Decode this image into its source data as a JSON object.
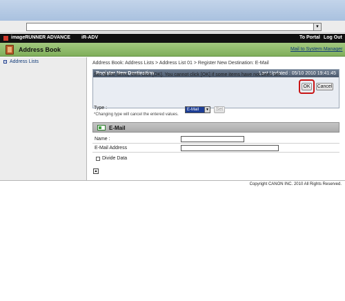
{
  "browser": {
    "url_arrow": "▼"
  },
  "header": {
    "product": "imageRUNNER ADVANCE",
    "model": "iR-ADV",
    "to_portal": "To Portal",
    "log_out": "Log Out"
  },
  "titlebar": {
    "title": "Address Book",
    "mail_link": "Mail to System Manager"
  },
  "sidebar": {
    "items": [
      {
        "label": "Address Lists"
      }
    ]
  },
  "main": {
    "breadcrumb": "Address Book: Address Lists > Address List 01 > Register New Destination: E-Mail",
    "panel_title": "Register New Destination",
    "last_updated": "Last Updated : 05/10 2010 19:41:45",
    "instructions": "Set all the items, then click [OK]. You cannot click [OK] if some items have not been set.",
    "ok_label": "OK",
    "cancel_label": "Cancel",
    "type_label": "Type :",
    "type_note": "*Changing type will cancel the entered values.",
    "type_value": "E-Mail",
    "type_arrow": "▼",
    "set_label": "Set",
    "section_title": "E-Mail",
    "fields": {
      "name_label": "Name :",
      "name_value": "",
      "email_label": "E-Mail Address",
      "email_value": "",
      "divide_label": "Divide Data",
      "divide_checked": false
    },
    "top_icon": "▲"
  },
  "footer": {
    "copyright": "Copyright CANON INC. 2010 All Rights Reserved."
  },
  "colors": {
    "title_bar": "#8fbd6a",
    "panel_head": "#5d6b7e",
    "ok_highlight": "#c81414"
  }
}
